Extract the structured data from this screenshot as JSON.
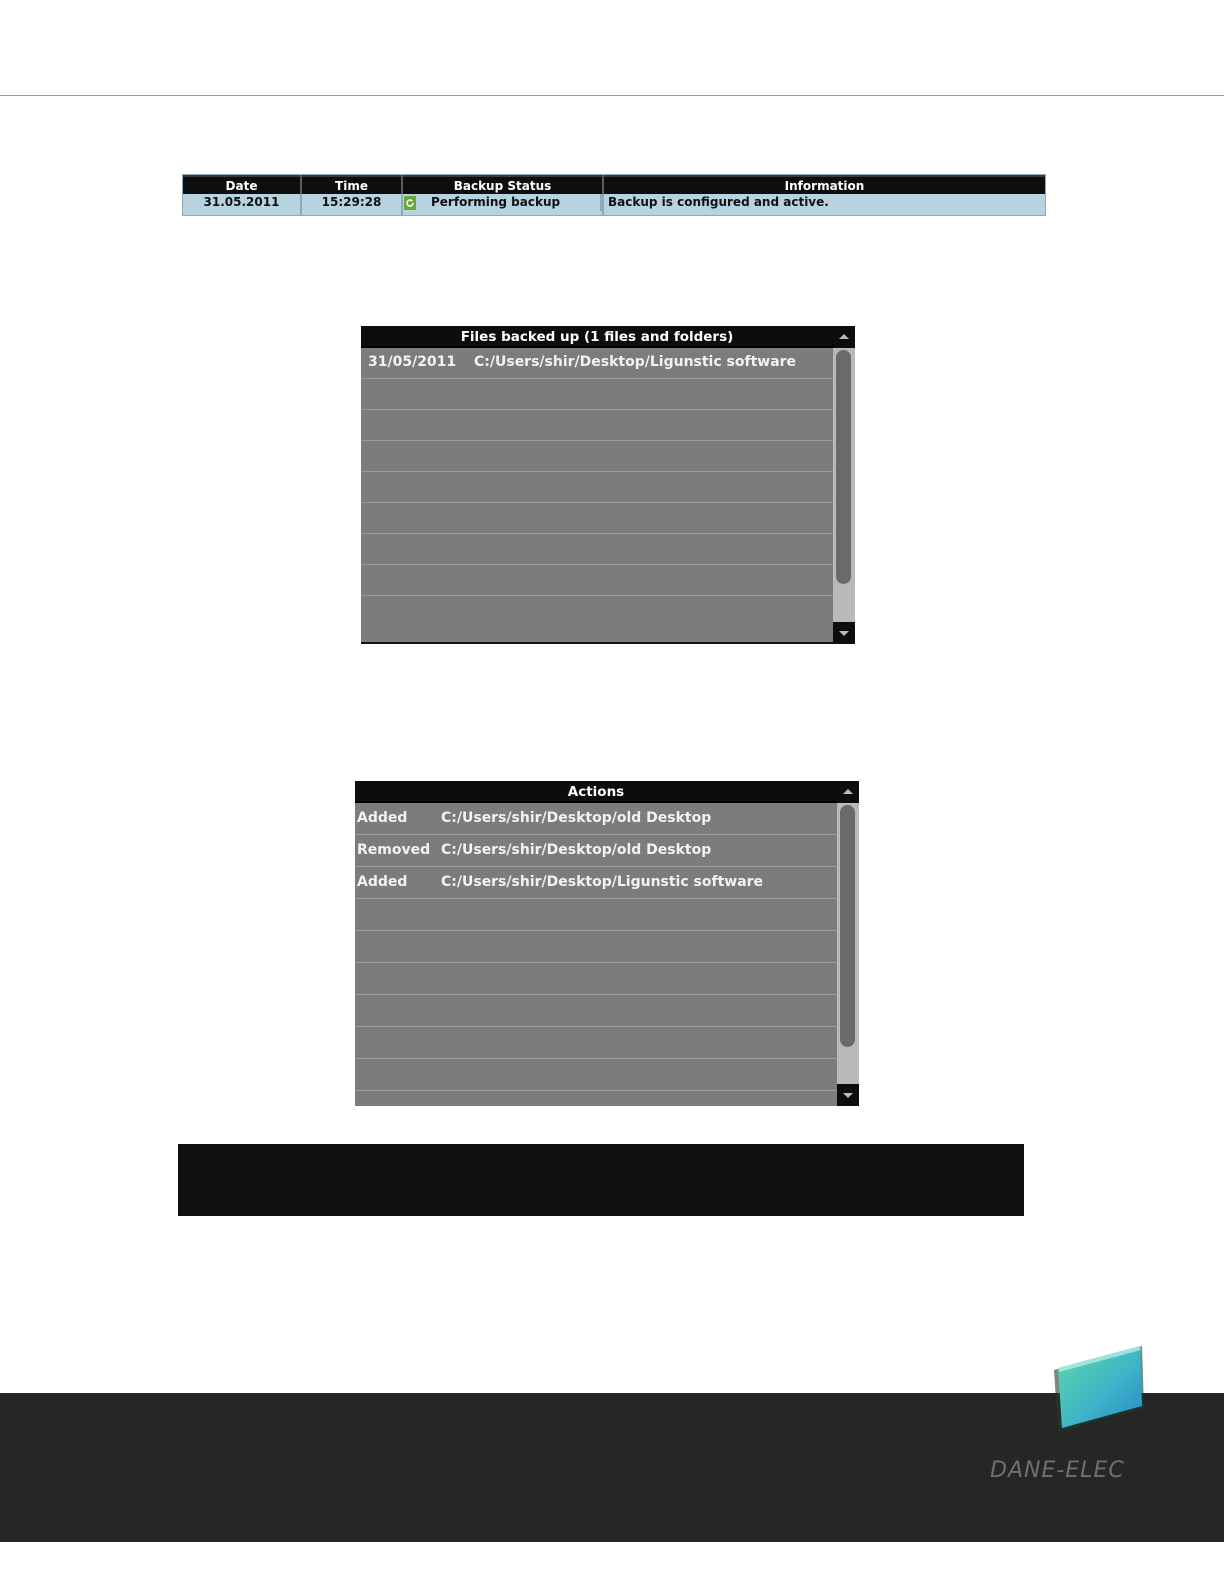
{
  "status_table": {
    "headers": [
      "Date",
      "Time",
      "Backup Status",
      "Information"
    ],
    "row": {
      "date": "31.05.2011",
      "time": "15:29:28",
      "status": "Performing backup",
      "status_icon": "refresh-icon",
      "info": "Backup is configured and active."
    }
  },
  "files_panel": {
    "title": "Files backed up (1 files and folders)",
    "items": [
      {
        "date": "31/05/2011",
        "path": "C:/Users/shir/Desktop/Ligunstic software"
      }
    ],
    "empty_rows": 8
  },
  "actions_panel": {
    "title": "Actions",
    "items": [
      {
        "action": "Added",
        "path": "C:/Users/shir/Desktop/old Desktop"
      },
      {
        "action": "Removed",
        "path": "C:/Users/shir/Desktop/old Desktop"
      },
      {
        "action": "Added",
        "path": "C:/Users/shir/Desktop/Ligunstic software"
      }
    ],
    "empty_rows": 7
  },
  "footer": {
    "brand": "DANE-ELEC"
  },
  "colors": {
    "header_bg": "#0d0d0d",
    "status_row_bg": "#b7d3e0",
    "panel_bg": "#7c7c7c",
    "status_icon": "#6aa836",
    "footer_bg": "#262626"
  }
}
